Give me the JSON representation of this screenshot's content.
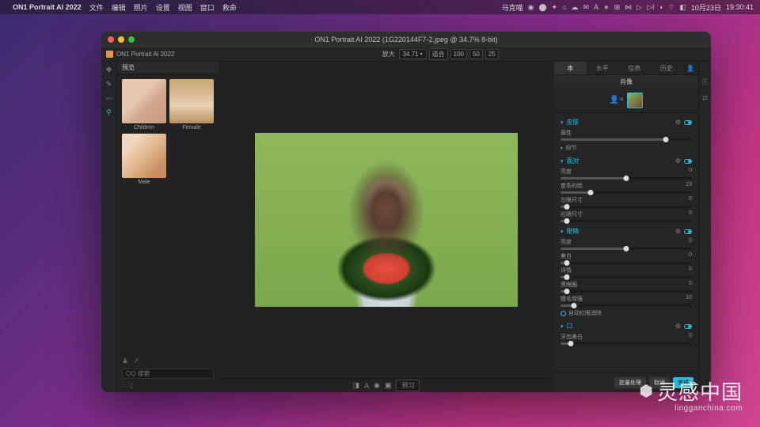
{
  "menubar": {
    "app": "ON1 Portrait AI 2022",
    "items": [
      "文件",
      "编辑",
      "照片",
      "设置",
      "视图",
      "窗口",
      "救命"
    ],
    "right": {
      "user": "马克喵",
      "date": "10月23日",
      "time": "19:30:41"
    }
  },
  "window": {
    "title": "ON1 Portrait AI 2022 (1G220144F7-2.jpeg @ 34.7% 8-bit)"
  },
  "approw": {
    "name": "ON1 Portrait Al 2022",
    "zoom_label": "放大",
    "zoom_value": "34.71",
    "fit_label": "适合",
    "sizes": [
      "100",
      "50",
      "25"
    ]
  },
  "left": {
    "tab": "预览",
    "presets": [
      {
        "label": "Children"
      },
      {
        "label": "Female"
      },
      {
        "label": "Male"
      }
    ],
    "search_ph": "Q 搜索"
  },
  "canvas": {
    "preview_btn": "预习"
  },
  "right": {
    "tabs": [
      "本",
      "水平",
      "信息",
      "历史"
    ],
    "header": "肖像",
    "sections": [
      {
        "name": "皮肤",
        "expand": true,
        "sliders": [
          {
            "label": "属性",
            "val": 80,
            "disp": ""
          }
        ],
        "sub": "细节"
      },
      {
        "name": "面对",
        "expand": true,
        "sliders": [
          {
            "label": "亮度",
            "val": 50,
            "disp": "0"
          },
          {
            "label": "苗条的脸",
            "val": 23,
            "disp": "23"
          },
          {
            "label": "左眼尺寸",
            "val": 5,
            "disp": "0"
          },
          {
            "label": "右眼尺寸",
            "val": 5,
            "disp": "0"
          }
        ]
      },
      {
        "name": "眼睛",
        "expand": true,
        "sliders": [
          {
            "label": "亮度",
            "val": 50,
            "disp": "0"
          },
          {
            "label": "美白",
            "val": 5,
            "disp": "0"
          },
          {
            "label": "详情",
            "val": 5,
            "disp": "0"
          },
          {
            "label": "黑眼圈",
            "val": 5,
            "disp": "0"
          },
          {
            "label": "睫毛增强",
            "val": 10,
            "disp": "10"
          }
        ],
        "check": "自动红眼消除"
      },
      {
        "name": "口",
        "expand": true,
        "sliders": [
          {
            "label": "牙齿美白",
            "val": 8,
            "disp": "0"
          }
        ]
      }
    ],
    "buttons": [
      "批量处理",
      "取消",
      "完成"
    ]
  },
  "watermark": {
    "big": "灵感中国",
    "small": "lingganchina.com"
  }
}
